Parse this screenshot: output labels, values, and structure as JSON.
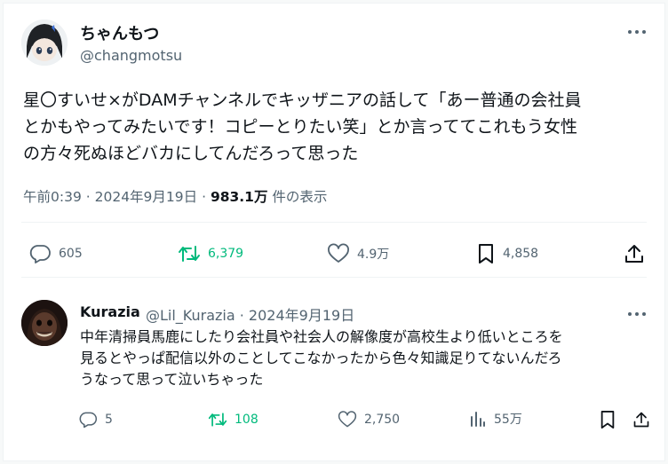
{
  "main_tweet": {
    "display_name": "ちゃんもつ",
    "handle": "@changmotsu",
    "text": "星〇すいせ×がDAMチャンネルでキッザニアの話して「あー普通の会社員\nとかもやってみたいです！コピーとりたい笑」とか言っててこれもう女性\nの方々死ぬほどバカにしてんだろって思った",
    "time": "午前0:39",
    "date": "2024年9月19日",
    "views_count": "983.1万",
    "views_label": "件の表示",
    "replies": "605",
    "retweets": "6,379",
    "likes": "4.9万",
    "bookmarks": "4,858"
  },
  "reply_tweet": {
    "display_name": "Kurazia",
    "handle_date": "@Lil_Kurazia · 2024年9月19日",
    "text": "中年清掃員馬鹿にしたり会社員や社会人の解像度が高校生より低いところを\n見るとやっぱ配信以外のことしてこなかったから色々知識足りてないんだろ\nうなって思って泣いちゃった",
    "replies": "5",
    "retweets": "108",
    "likes": "2,750",
    "views": "55万"
  },
  "colors": {
    "text": "#0f1419",
    "secondary": "#536471",
    "retweet_green": "#00ba7c",
    "divider": "#eff3f4"
  },
  "icons": [
    "more-icon",
    "reply-icon",
    "retweet-icon",
    "like-icon",
    "bookmark-icon",
    "share-icon",
    "views-icon"
  ]
}
